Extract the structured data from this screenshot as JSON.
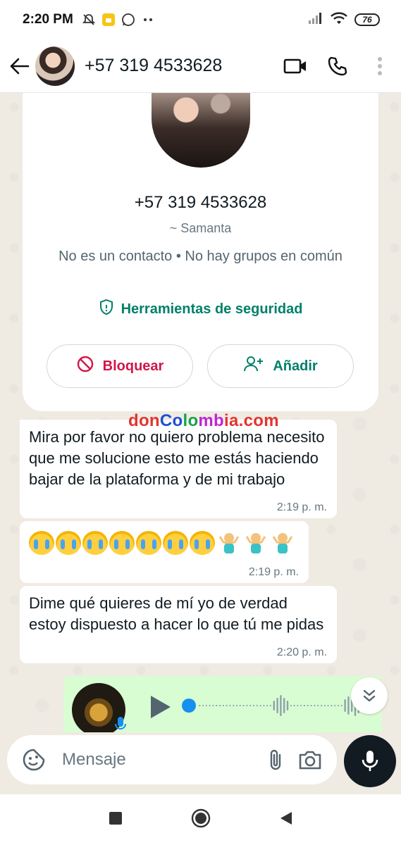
{
  "status_bar": {
    "time": "2:20 PM",
    "battery": "76"
  },
  "header": {
    "title": "+57 319 4533628"
  },
  "contact_card": {
    "phone": "+57 319 4533628",
    "name": "~ Samanta",
    "info": "No es un contacto • No hay grupos en común",
    "safety_tools": "Herramientas de seguridad",
    "block_label": "Bloquear",
    "add_label": "Añadir"
  },
  "watermark": {
    "part1": "don",
    "part2": "Co",
    "part3": "lo",
    "part4": "mb",
    "part5": "ia.com"
  },
  "messages": [
    {
      "text": "Mira por favor no quiero problema necesito que me solucione esto me estás haciendo bajar de la plataforma y de mi trabajo",
      "time": "2:19 p. m."
    },
    {
      "text": "",
      "time": "2:19 p. m."
    },
    {
      "text": "Dime qué quieres de mí yo de verdad estoy dispuesto a hacer lo que tú me pidas",
      "time": "2:20 p. m."
    }
  ],
  "emoji_message": {
    "crying_count": 7,
    "shrug_count": 3
  },
  "input": {
    "placeholder": "Mensaje"
  },
  "colors": {
    "accent": "#008069",
    "danger": "#d0174a",
    "outgoing_bubble": "#d9fdd3",
    "chat_bg": "#efeae2"
  }
}
